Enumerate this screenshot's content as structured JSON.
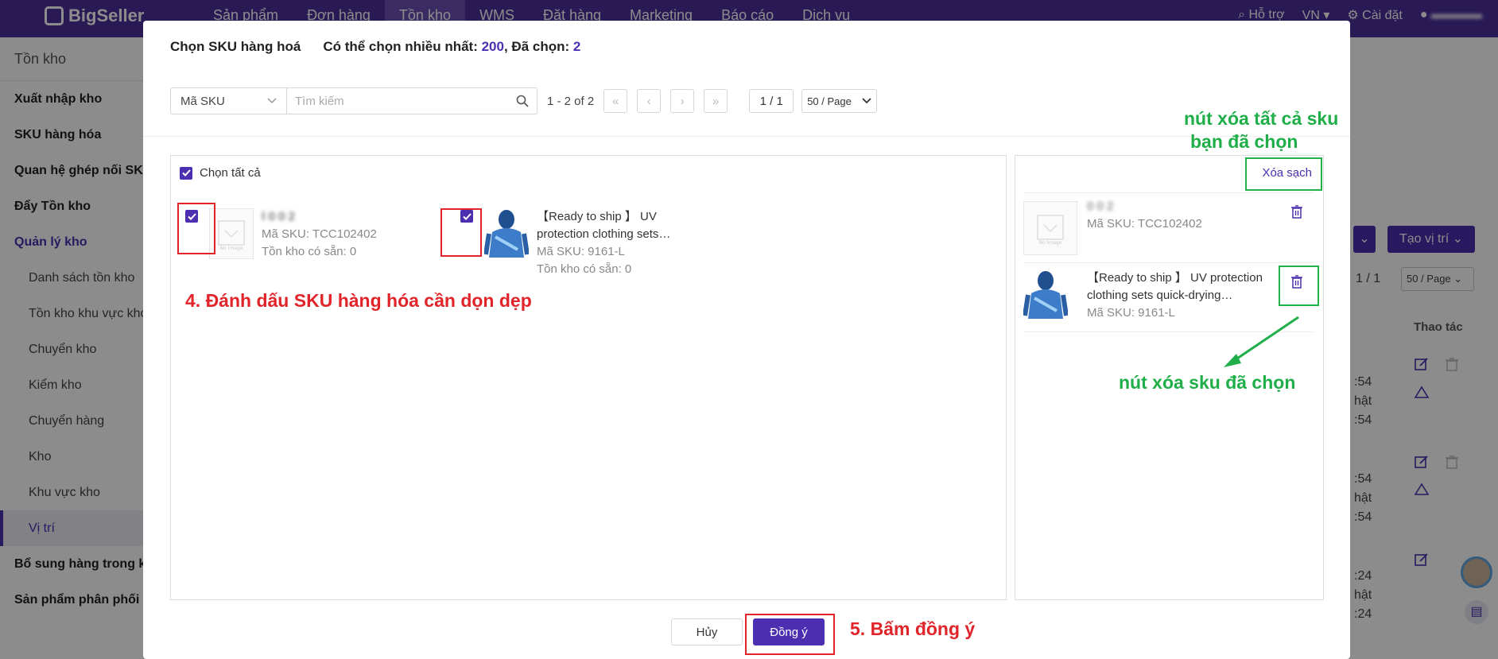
{
  "topnav": {
    "logo": "BigSeller",
    "menu": [
      "Sản phẩm",
      "Đơn hàng",
      "Tồn kho",
      "WMS",
      "Đặt hàng",
      "Marketing",
      "Báo cáo",
      "Dịch vụ"
    ],
    "support": "Hỗ trợ",
    "lang": "VN",
    "settings": "Cài đặt"
  },
  "sidebar": {
    "title": "Tồn kho",
    "items": [
      "Xuất nhập kho",
      "SKU hàng hóa",
      "Quan hệ ghép nối SKU",
      "Đẩy Tồn kho",
      "Quản lý kho",
      "Danh sách tồn kho",
      "Tồn kho khu vực kho",
      "Chuyển kho",
      "Kiểm kho",
      "Chuyển hàng",
      "Kho",
      "Khu vực kho",
      "Vị trí",
      "Bổ sung hàng trong kho",
      "Sản phẩm phân phối"
    ]
  },
  "background": {
    "create_location": "Tạo vị trí",
    "page": "1 / 1",
    "pagesize": "50 / Page",
    "actions_header": "Thao tác",
    "times": [
      ":54",
      "hật",
      ":54",
      ":54",
      "hật",
      ":54",
      ":24",
      "hật",
      ":24"
    ]
  },
  "modal": {
    "title": "Chọn SKU hàng hoá",
    "max_label": "Có thể chọn nhiều nhất: ",
    "max_value": "200",
    "selected_label": ", Đã chọn: ",
    "selected_value": "2",
    "filter_select": "Mã SKU",
    "search_placeholder": "Tìm kiếm",
    "range": "1 - 2 of 2",
    "page": "1 / 1",
    "pagesize": "50 / Page",
    "select_all": "Chọn tất cả",
    "clear_all": "Xóa sạch",
    "cancel": "Hủy",
    "ok": "Đồng ý",
    "no_image": "No Image",
    "products": [
      {
        "name": "Ⅰ 0 0 2",
        "sku": "Mã SKU: TCC102402",
        "stock": "Tồn kho có sẵn: 0"
      },
      {
        "name": "【Ready to ship 】 UV protection clothing sets…",
        "sku": "Mã SKU: 9161-L",
        "stock": "Tồn kho có sẵn: 0"
      }
    ],
    "selected": [
      {
        "name": "0 0 2",
        "sku": "Mã SKU: TCC102402"
      },
      {
        "name": "【Ready to ship 】 UV protection clothing sets quick-drying…",
        "sku": "Mã SKU: 9161-L"
      }
    ]
  },
  "annotations": {
    "step4": "4. Đánh dấu SKU hàng hóa cần dọn dẹp",
    "step5": "5. Bấm đồng ý",
    "clear_all_note_1": "nút xóa tất cả sku",
    "clear_all_note_2": "bạn đã chọn",
    "delete_note": "nút xóa sku đã chọn"
  },
  "colors": {
    "brand": "#4b2fb0",
    "nav": "#4b2f9c",
    "annotation_red": "#e0242a",
    "annotation_green": "#1fae48"
  }
}
